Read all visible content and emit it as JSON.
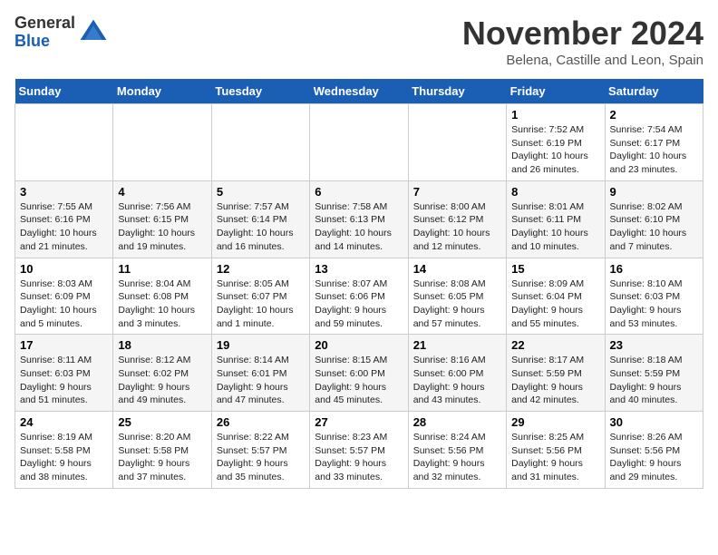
{
  "logo": {
    "general": "General",
    "blue": "Blue"
  },
  "title": "November 2024",
  "location": "Belena, Castille and Leon, Spain",
  "days_of_week": [
    "Sunday",
    "Monday",
    "Tuesday",
    "Wednesday",
    "Thursday",
    "Friday",
    "Saturday"
  ],
  "weeks": [
    [
      {
        "day": "",
        "info": ""
      },
      {
        "day": "",
        "info": ""
      },
      {
        "day": "",
        "info": ""
      },
      {
        "day": "",
        "info": ""
      },
      {
        "day": "",
        "info": ""
      },
      {
        "day": "1",
        "info": "Sunrise: 7:52 AM\nSunset: 6:19 PM\nDaylight: 10 hours and 26 minutes."
      },
      {
        "day": "2",
        "info": "Sunrise: 7:54 AM\nSunset: 6:17 PM\nDaylight: 10 hours and 23 minutes."
      }
    ],
    [
      {
        "day": "3",
        "info": "Sunrise: 7:55 AM\nSunset: 6:16 PM\nDaylight: 10 hours and 21 minutes."
      },
      {
        "day": "4",
        "info": "Sunrise: 7:56 AM\nSunset: 6:15 PM\nDaylight: 10 hours and 19 minutes."
      },
      {
        "day": "5",
        "info": "Sunrise: 7:57 AM\nSunset: 6:14 PM\nDaylight: 10 hours and 16 minutes."
      },
      {
        "day": "6",
        "info": "Sunrise: 7:58 AM\nSunset: 6:13 PM\nDaylight: 10 hours and 14 minutes."
      },
      {
        "day": "7",
        "info": "Sunrise: 8:00 AM\nSunset: 6:12 PM\nDaylight: 10 hours and 12 minutes."
      },
      {
        "day": "8",
        "info": "Sunrise: 8:01 AM\nSunset: 6:11 PM\nDaylight: 10 hours and 10 minutes."
      },
      {
        "day": "9",
        "info": "Sunrise: 8:02 AM\nSunset: 6:10 PM\nDaylight: 10 hours and 7 minutes."
      }
    ],
    [
      {
        "day": "10",
        "info": "Sunrise: 8:03 AM\nSunset: 6:09 PM\nDaylight: 10 hours and 5 minutes."
      },
      {
        "day": "11",
        "info": "Sunrise: 8:04 AM\nSunset: 6:08 PM\nDaylight: 10 hours and 3 minutes."
      },
      {
        "day": "12",
        "info": "Sunrise: 8:05 AM\nSunset: 6:07 PM\nDaylight: 10 hours and 1 minute."
      },
      {
        "day": "13",
        "info": "Sunrise: 8:07 AM\nSunset: 6:06 PM\nDaylight: 9 hours and 59 minutes."
      },
      {
        "day": "14",
        "info": "Sunrise: 8:08 AM\nSunset: 6:05 PM\nDaylight: 9 hours and 57 minutes."
      },
      {
        "day": "15",
        "info": "Sunrise: 8:09 AM\nSunset: 6:04 PM\nDaylight: 9 hours and 55 minutes."
      },
      {
        "day": "16",
        "info": "Sunrise: 8:10 AM\nSunset: 6:03 PM\nDaylight: 9 hours and 53 minutes."
      }
    ],
    [
      {
        "day": "17",
        "info": "Sunrise: 8:11 AM\nSunset: 6:03 PM\nDaylight: 9 hours and 51 minutes."
      },
      {
        "day": "18",
        "info": "Sunrise: 8:12 AM\nSunset: 6:02 PM\nDaylight: 9 hours and 49 minutes."
      },
      {
        "day": "19",
        "info": "Sunrise: 8:14 AM\nSunset: 6:01 PM\nDaylight: 9 hours and 47 minutes."
      },
      {
        "day": "20",
        "info": "Sunrise: 8:15 AM\nSunset: 6:00 PM\nDaylight: 9 hours and 45 minutes."
      },
      {
        "day": "21",
        "info": "Sunrise: 8:16 AM\nSunset: 6:00 PM\nDaylight: 9 hours and 43 minutes."
      },
      {
        "day": "22",
        "info": "Sunrise: 8:17 AM\nSunset: 5:59 PM\nDaylight: 9 hours and 42 minutes."
      },
      {
        "day": "23",
        "info": "Sunrise: 8:18 AM\nSunset: 5:59 PM\nDaylight: 9 hours and 40 minutes."
      }
    ],
    [
      {
        "day": "24",
        "info": "Sunrise: 8:19 AM\nSunset: 5:58 PM\nDaylight: 9 hours and 38 minutes."
      },
      {
        "day": "25",
        "info": "Sunrise: 8:20 AM\nSunset: 5:58 PM\nDaylight: 9 hours and 37 minutes."
      },
      {
        "day": "26",
        "info": "Sunrise: 8:22 AM\nSunset: 5:57 PM\nDaylight: 9 hours and 35 minutes."
      },
      {
        "day": "27",
        "info": "Sunrise: 8:23 AM\nSunset: 5:57 PM\nDaylight: 9 hours and 33 minutes."
      },
      {
        "day": "28",
        "info": "Sunrise: 8:24 AM\nSunset: 5:56 PM\nDaylight: 9 hours and 32 minutes."
      },
      {
        "day": "29",
        "info": "Sunrise: 8:25 AM\nSunset: 5:56 PM\nDaylight: 9 hours and 31 minutes."
      },
      {
        "day": "30",
        "info": "Sunrise: 8:26 AM\nSunset: 5:56 PM\nDaylight: 9 hours and 29 minutes."
      }
    ]
  ]
}
